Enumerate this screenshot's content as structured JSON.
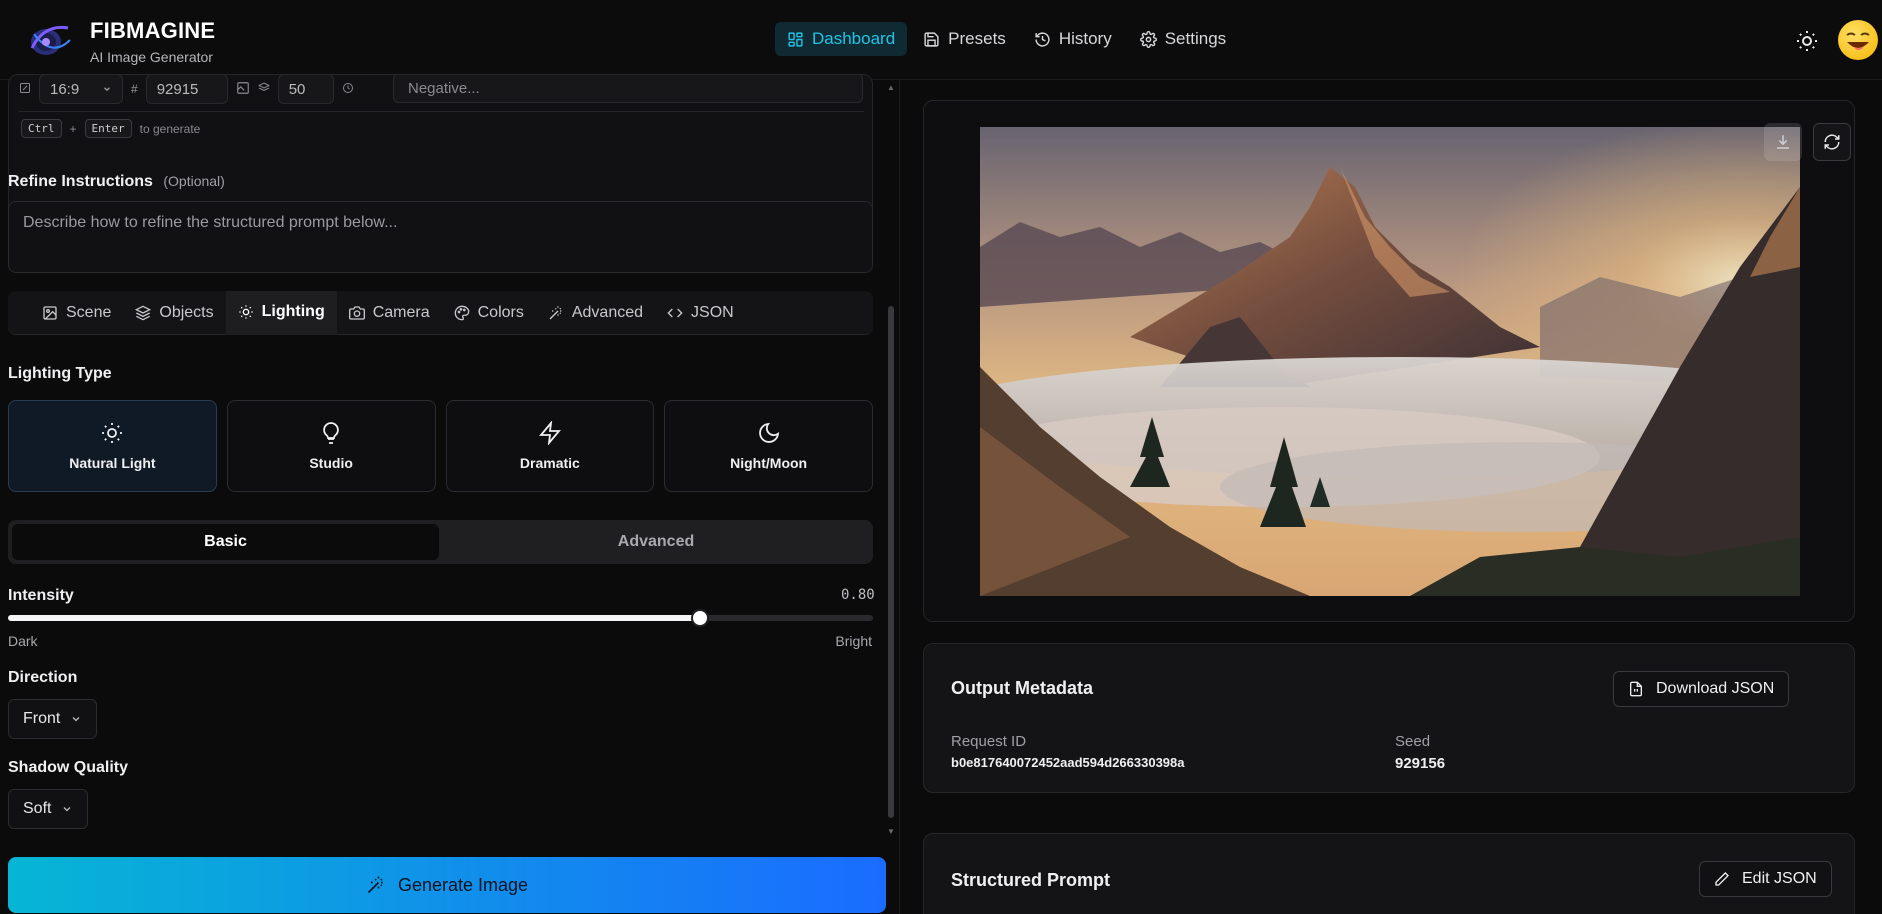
{
  "app": {
    "name": "FIBMAGINE",
    "tagline": "AI Image Generator"
  },
  "nav": [
    {
      "label": "Dashboard",
      "icon": "dashboard-icon",
      "active": true
    },
    {
      "label": "Presets",
      "icon": "save-icon",
      "active": false
    },
    {
      "label": "History",
      "icon": "history-icon",
      "active": false
    },
    {
      "label": "Settings",
      "icon": "gear-icon",
      "active": false
    }
  ],
  "options_row": {
    "aspect_ratio": "16:9",
    "seed": "92915",
    "steps": "50",
    "negative_placeholder": "Negative..."
  },
  "shortcut": {
    "key1": "Ctrl",
    "plus": "+",
    "key2": "Enter",
    "hint": "to generate"
  },
  "refine": {
    "label": "Refine Instructions",
    "optional": "(Optional)",
    "placeholder": "Describe how to refine the structured prompt below..."
  },
  "tabs": [
    {
      "label": "Scene",
      "icon": "image-icon",
      "active": false
    },
    {
      "label": "Objects",
      "icon": "layers-icon",
      "active": false
    },
    {
      "label": "Lighting",
      "icon": "sun-icon",
      "active": true
    },
    {
      "label": "Camera",
      "icon": "camera-icon",
      "active": false
    },
    {
      "label": "Colors",
      "icon": "palette-icon",
      "active": false
    },
    {
      "label": "Advanced",
      "icon": "wand-icon",
      "active": false
    },
    {
      "label": "JSON",
      "icon": "code-icon",
      "active": false
    }
  ],
  "lighting": {
    "type_label": "Lighting Type",
    "types": [
      {
        "label": "Natural Light",
        "icon": "sun-icon",
        "active": true
      },
      {
        "label": "Studio",
        "icon": "lightbulb-icon",
        "active": false
      },
      {
        "label": "Dramatic",
        "icon": "lightning-icon",
        "active": false
      },
      {
        "label": "Night/Moon",
        "icon": "moon-icon",
        "active": false
      }
    ],
    "mode_basic": "Basic",
    "mode_advanced": "Advanced",
    "intensity_label": "Intensity",
    "intensity_value": 0.8,
    "intensity_display": "0.80",
    "intensity_min_label": "Dark",
    "intensity_max_label": "Bright",
    "direction_label": "Direction",
    "direction_value": "Front",
    "shadow_label": "Shadow Quality",
    "shadow_value": "Soft"
  },
  "generate_label": "Generate Image",
  "metadata": {
    "title": "Output Metadata",
    "download_label": "Download JSON",
    "request_id_label": "Request ID",
    "request_id": "b0e817640072452aad594d266330398a",
    "seed_label": "Seed",
    "seed": "929156"
  },
  "structured_prompt": {
    "title": "Structured Prompt",
    "edit_label": "Edit JSON"
  },
  "colors": {
    "accent": "#22c3e6",
    "generate_gradient_start": "#06b6d4",
    "generate_gradient_end": "#1a6cff"
  }
}
